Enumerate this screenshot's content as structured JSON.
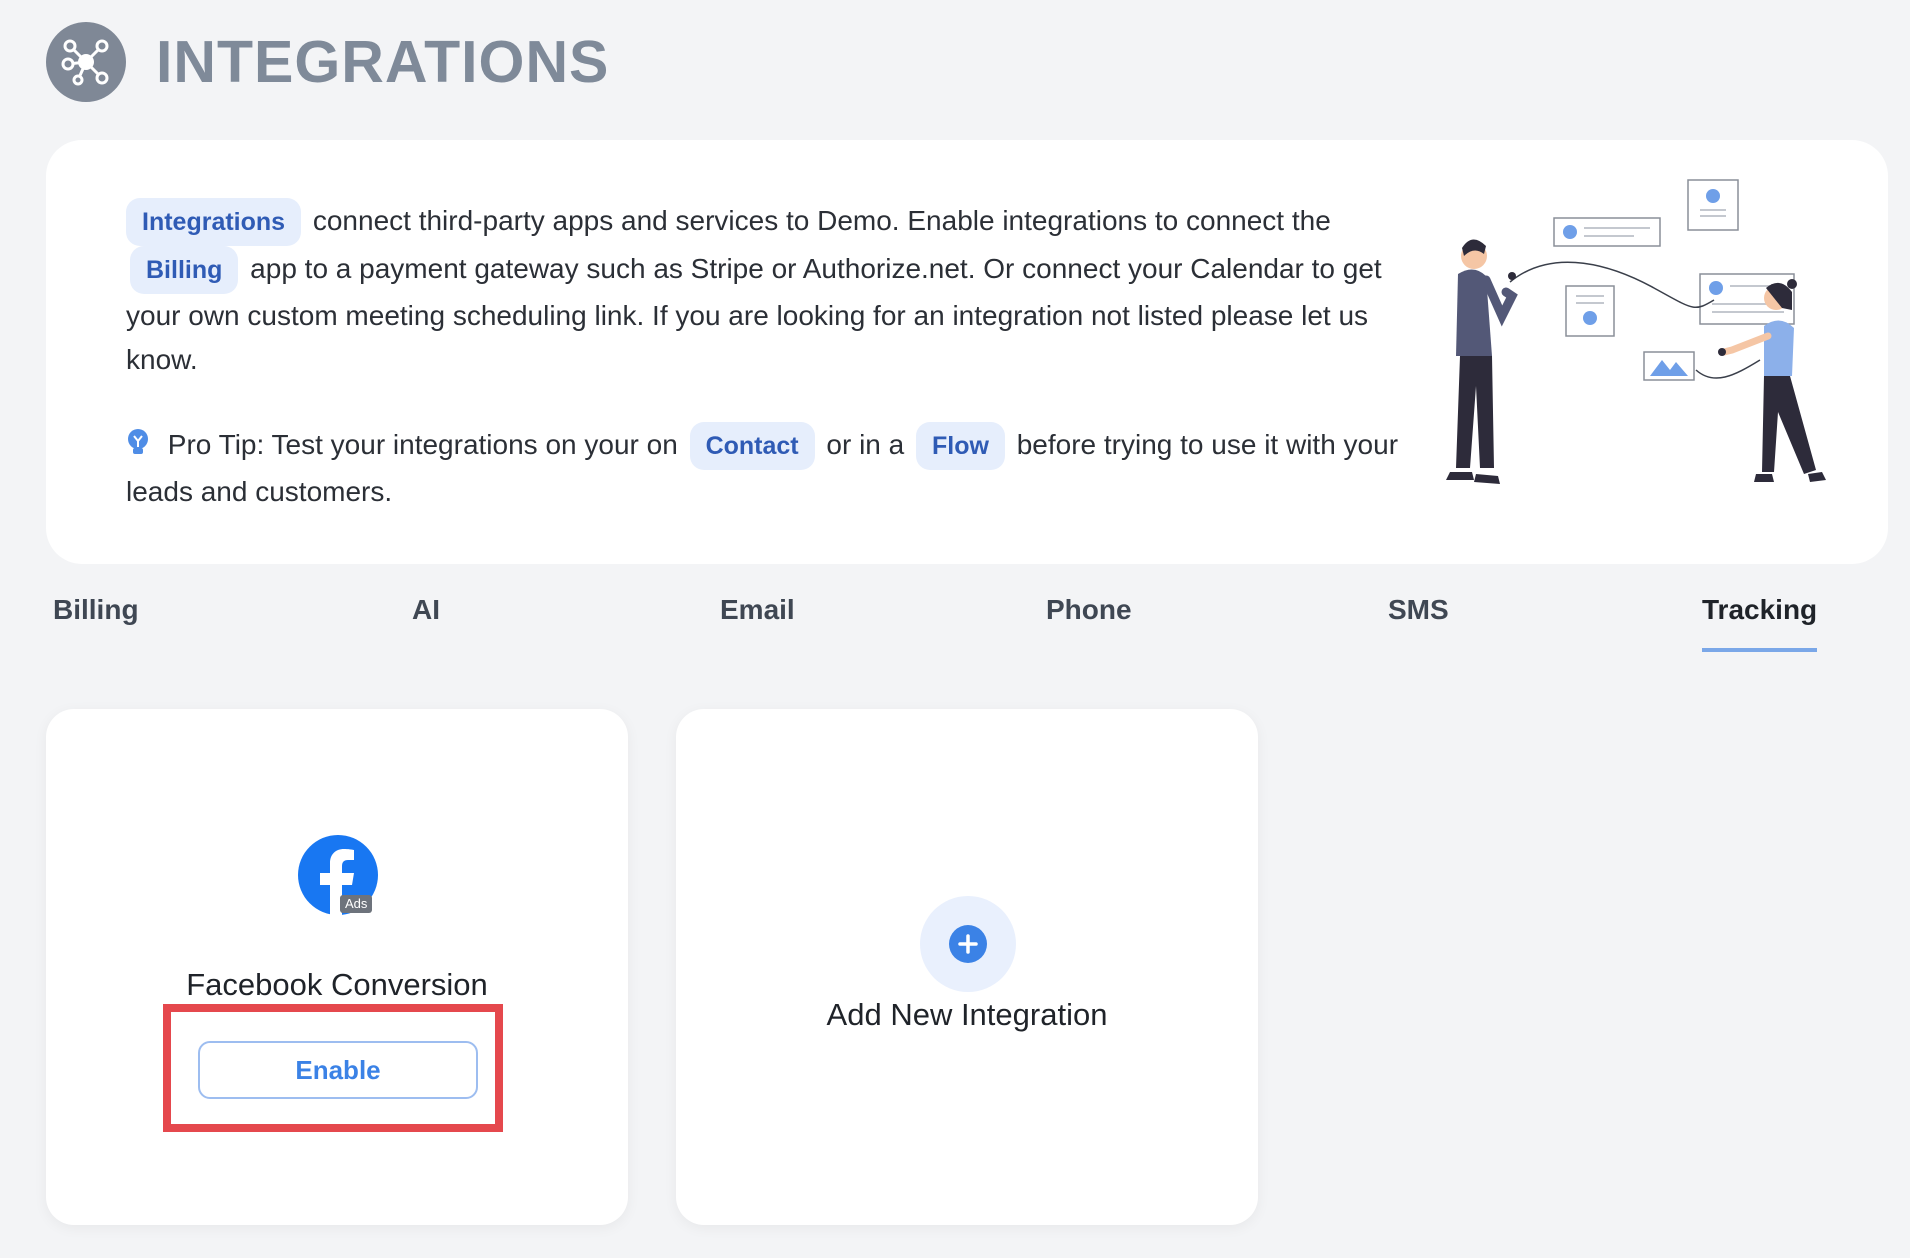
{
  "header": {
    "title": "INTEGRATIONS",
    "icon": "integrations-network-icon"
  },
  "info": {
    "pill_integrations": "Integrations",
    "text_1": "connect third-party apps and services to Demo. Enable integrations to connect the",
    "pill_billing": "Billing",
    "text_2": "app to a payment gateway such as Stripe or Authorize.net. Or connect your Calendar to get your own custom meeting scheduling link. If you are looking for an integration not listed please let us know.",
    "tip_prefix": "Pro Tip: Test your integrations on your on",
    "pill_contact": "Contact",
    "tip_middle": "or in a",
    "pill_flow": "Flow",
    "tip_suffix": "before trying to use it with your leads and customers.",
    "tip_icon": "lightbulb-icon",
    "illustration": "people-connecting-illustration"
  },
  "tabs": [
    {
      "label": "Billing",
      "active": false
    },
    {
      "label": "AI",
      "active": false
    },
    {
      "label": "Email",
      "active": false
    },
    {
      "label": "Phone",
      "active": false
    },
    {
      "label": "SMS",
      "active": false
    },
    {
      "label": "Tracking",
      "active": true
    }
  ],
  "cards": {
    "facebook": {
      "title": "Facebook Conversion",
      "badge": "Ads",
      "button": "Enable",
      "icon": "facebook-ads-icon"
    },
    "add_new": {
      "title": "Add New Integration",
      "icon": "plus-icon"
    }
  },
  "colors": {
    "accent": "#3b82e6",
    "highlight": "#e5484d",
    "background": "#f3f4f6",
    "pill_bg": "#e6eefc"
  }
}
